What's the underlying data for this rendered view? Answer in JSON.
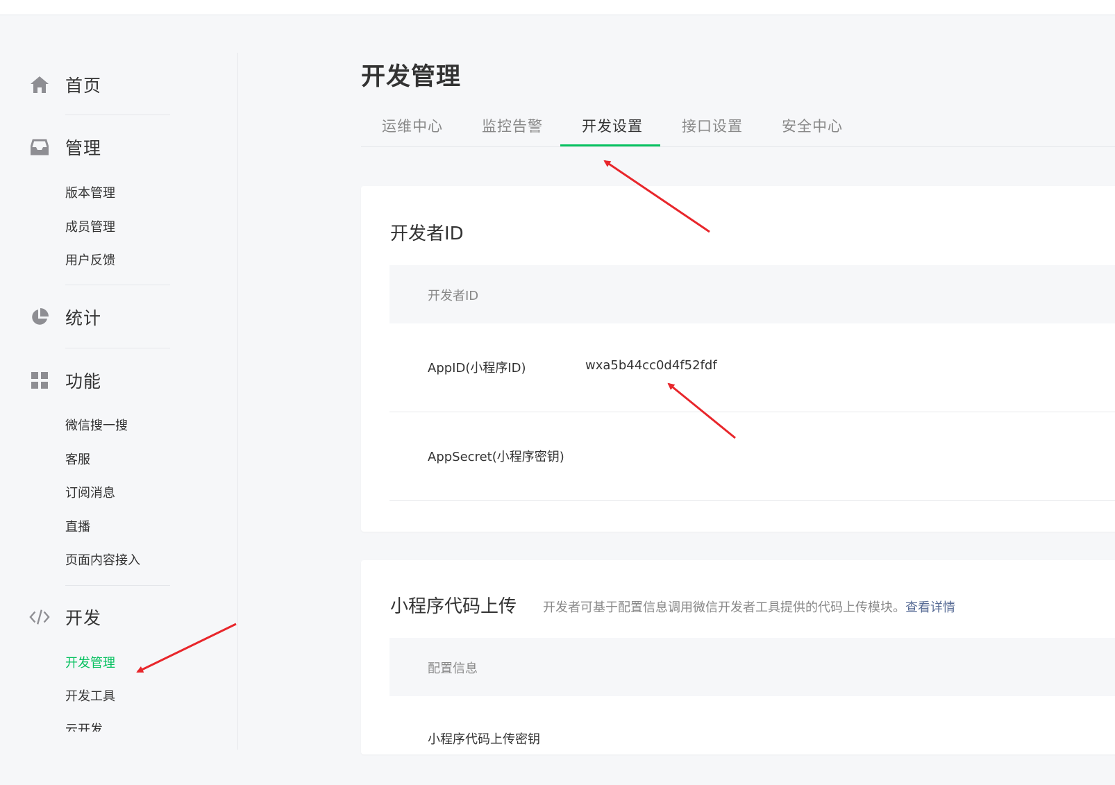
{
  "sidebar": {
    "home": {
      "label": "首页",
      "icon": "home-icon"
    },
    "manage": {
      "label": "管理",
      "icon": "inbox-icon",
      "items": [
        "版本管理",
        "成员管理",
        "用户反馈"
      ]
    },
    "stats": {
      "label": "统计",
      "icon": "pie-chart-icon"
    },
    "features": {
      "label": "功能",
      "icon": "grid-icon",
      "items": [
        "微信搜一搜",
        "客服",
        "订阅消息",
        "直播",
        "页面内容接入"
      ]
    },
    "dev": {
      "label": "开发",
      "icon": "code-icon",
      "items": [
        "开发管理",
        "开发工具",
        "云开发"
      ],
      "active_index": 0
    }
  },
  "main": {
    "title": "开发管理",
    "tabs": [
      "运维中心",
      "监控告警",
      "开发设置",
      "接口设置",
      "安全中心"
    ],
    "active_tab": 2,
    "developer_id_card": {
      "title": "开发者ID",
      "header": "开发者ID",
      "rows": [
        {
          "key": "AppID(小程序ID)",
          "value": "wxa5b44cc0d4f52fdf"
        },
        {
          "key": "AppSecret(小程序密钥)",
          "value": ""
        }
      ]
    },
    "upload_card": {
      "title": "小程序代码上传",
      "desc": "开发者可基于配置信息调用微信开发者工具提供的代码上传模块。",
      "link": "查看详情",
      "header": "配置信息",
      "rows": [
        {
          "key": "小程序代码上传密钥",
          "value": ""
        }
      ]
    }
  },
  "colors": {
    "accent": "#07c160",
    "link": "#576b95",
    "annotation_arrow": "#e8262b"
  }
}
